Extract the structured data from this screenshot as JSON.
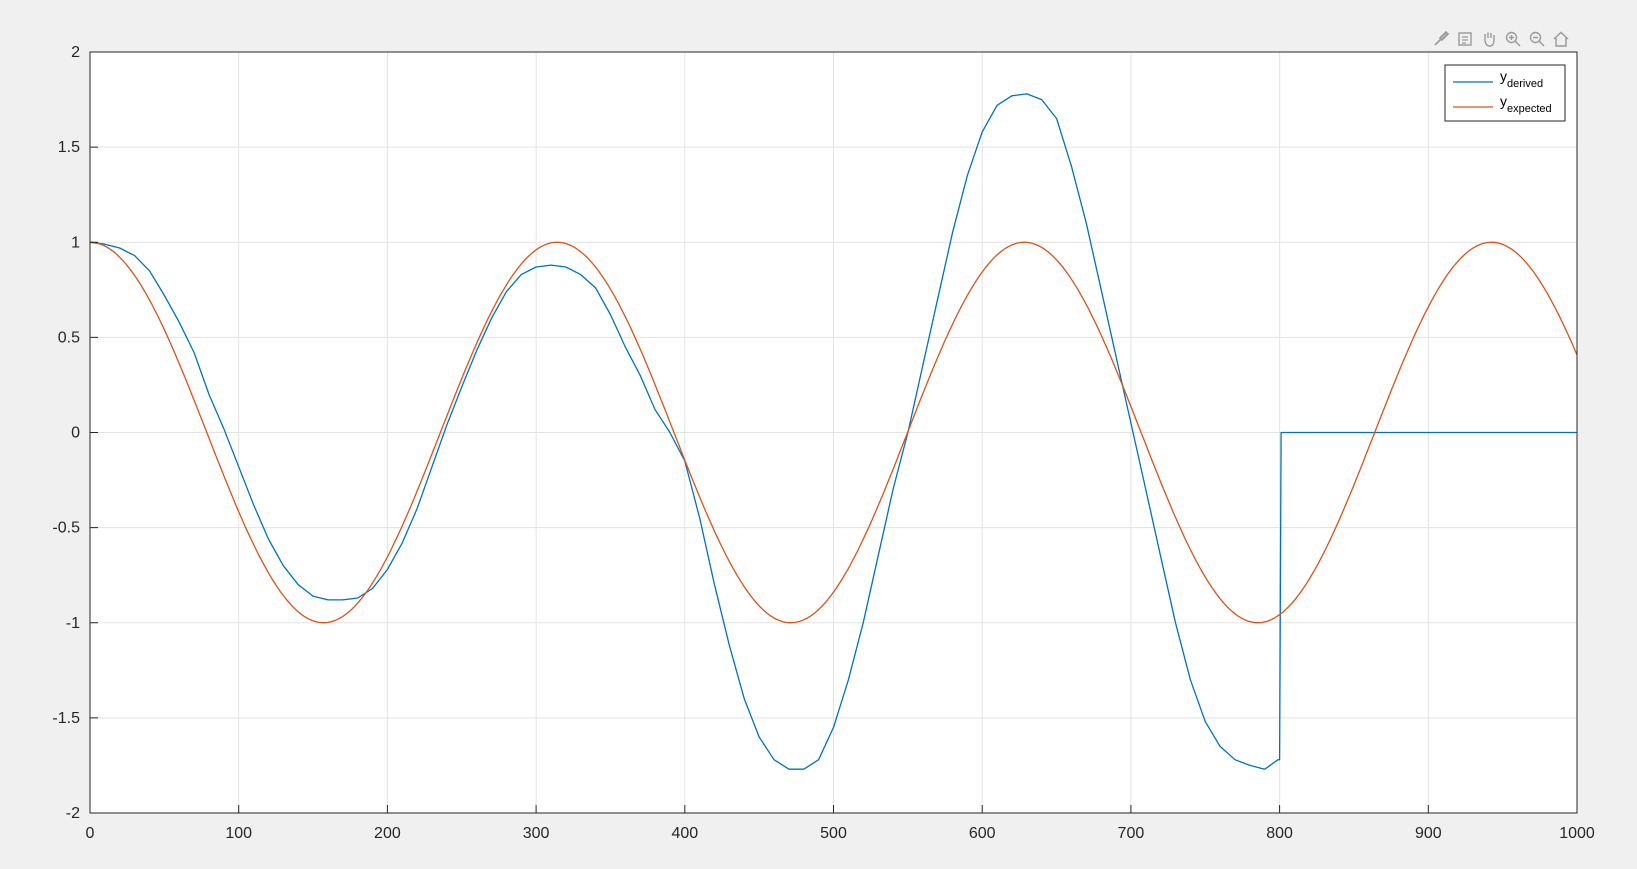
{
  "toolbar": {
    "icons": [
      "brush-icon",
      "data-tips-icon",
      "pan-hand-icon",
      "zoom-in-icon",
      "zoom-out-icon",
      "home-icon"
    ]
  },
  "chart_data": {
    "type": "line",
    "title": "",
    "xlabel": "",
    "ylabel": "",
    "xlim": [
      0,
      1000
    ],
    "ylim": [
      -2,
      2
    ],
    "xticks": [
      0,
      100,
      200,
      300,
      400,
      500,
      600,
      700,
      800,
      900,
      1000
    ],
    "yticks": [
      -2,
      -1.5,
      -1,
      -0.5,
      0,
      0.5,
      1,
      1.5,
      2
    ],
    "grid": true,
    "legend_position": "top-right",
    "series": [
      {
        "name_base": "y",
        "name_sub": "derived",
        "color": "#0072BD",
        "x": [
          0,
          10,
          20,
          30,
          40,
          50,
          60,
          70,
          80,
          90,
          100,
          110,
          120,
          130,
          140,
          150,
          160,
          170,
          180,
          190,
          200,
          210,
          220,
          230,
          240,
          250,
          260,
          270,
          280,
          290,
          300,
          310,
          320,
          330,
          340,
          350,
          360,
          370,
          380,
          390,
          400,
          410,
          420,
          430,
          440,
          450,
          460,
          470,
          480,
          490,
          500,
          510,
          520,
          530,
          540,
          550,
          560,
          570,
          580,
          590,
          600,
          610,
          620,
          630,
          640,
          650,
          660,
          670,
          680,
          690,
          700,
          710,
          720,
          730,
          740,
          750,
          760,
          770,
          780,
          790,
          799,
          800,
          801,
          900,
          1000
        ],
        "y": [
          1.0,
          0.99,
          0.97,
          0.93,
          0.85,
          0.72,
          0.58,
          0.42,
          0.2,
          0.02,
          -0.18,
          -0.38,
          -0.56,
          -0.7,
          -0.8,
          -0.86,
          -0.88,
          -0.88,
          -0.87,
          -0.82,
          -0.72,
          -0.58,
          -0.4,
          -0.18,
          0.04,
          0.24,
          0.43,
          0.6,
          0.74,
          0.83,
          0.87,
          0.88,
          0.87,
          0.83,
          0.76,
          0.62,
          0.45,
          0.3,
          0.12,
          0.0,
          -0.15,
          -0.45,
          -0.8,
          -1.12,
          -1.4,
          -1.6,
          -1.72,
          -1.77,
          -1.77,
          -1.72,
          -1.55,
          -1.3,
          -1.0,
          -0.65,
          -0.3,
          0.0,
          0.35,
          0.7,
          1.05,
          1.35,
          1.58,
          1.72,
          1.77,
          1.78,
          1.75,
          1.65,
          1.4,
          1.1,
          0.75,
          0.4,
          0.05,
          -0.3,
          -0.65,
          -1.0,
          -1.3,
          -1.52,
          -1.65,
          -1.72,
          -1.75,
          -1.77,
          -1.72,
          -1.72,
          0.0,
          0.0,
          0.0
        ]
      },
      {
        "name_base": "y",
        "name_sub": "expected",
        "color": "#D95319",
        "function": "cos",
        "period": 314.16,
        "amplitude": 1
      }
    ]
  }
}
